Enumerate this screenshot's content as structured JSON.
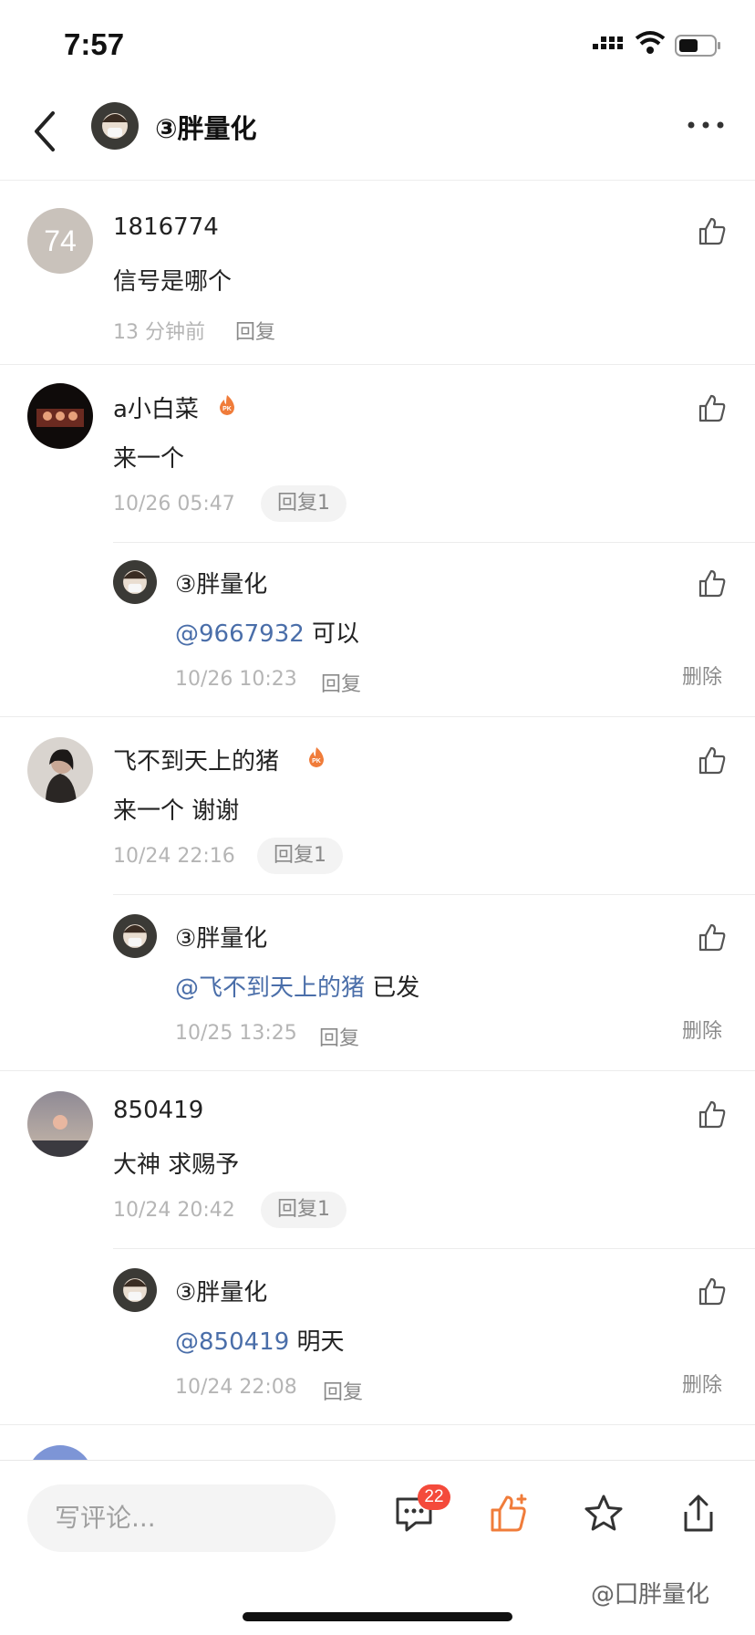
{
  "status_bar": {
    "time": "7:57"
  },
  "header": {
    "title": "③胖量化"
  },
  "comments": [
    {
      "user": "1816774",
      "avatar_text": "74",
      "text": "信号是哪个",
      "time": "13 分钟前",
      "reply_label": "回复"
    },
    {
      "user": "a小白菜",
      "text": "来一个",
      "time": "10/26 05:47",
      "reply_label": "回复1",
      "reply": {
        "user": "③胖量化",
        "mention": "@9667932",
        "text": " 可以",
        "time": "10/26 10:23",
        "reply_label": "回复",
        "delete_label": "删除"
      }
    },
    {
      "user": "飞不到天上的猪",
      "text": "来一个 谢谢",
      "time": "10/24 22:16",
      "reply_label": "回复1",
      "reply": {
        "user": "③胖量化",
        "mention": "@飞不到天上的猪",
        "text": " 已发",
        "time": "10/25 13:25",
        "reply_label": "回复",
        "delete_label": "删除"
      }
    },
    {
      "user": "850419",
      "text": "大神 求赐予",
      "time": "10/24 20:42",
      "reply_label": "回复1",
      "reply": {
        "user": "③胖量化",
        "mention": "@850419",
        "text": " 明天",
        "time": "10/24 22:08",
        "reply_label": "回复",
        "delete_label": "删除"
      }
    }
  ],
  "bottom_bar": {
    "input_placeholder": "写评论...",
    "comment_count": "22",
    "watermark": "@囗胖量化"
  },
  "colors": {
    "mention": "#4a6ea9",
    "like_active": "#f07c3a",
    "badge": "#f44a3b"
  }
}
